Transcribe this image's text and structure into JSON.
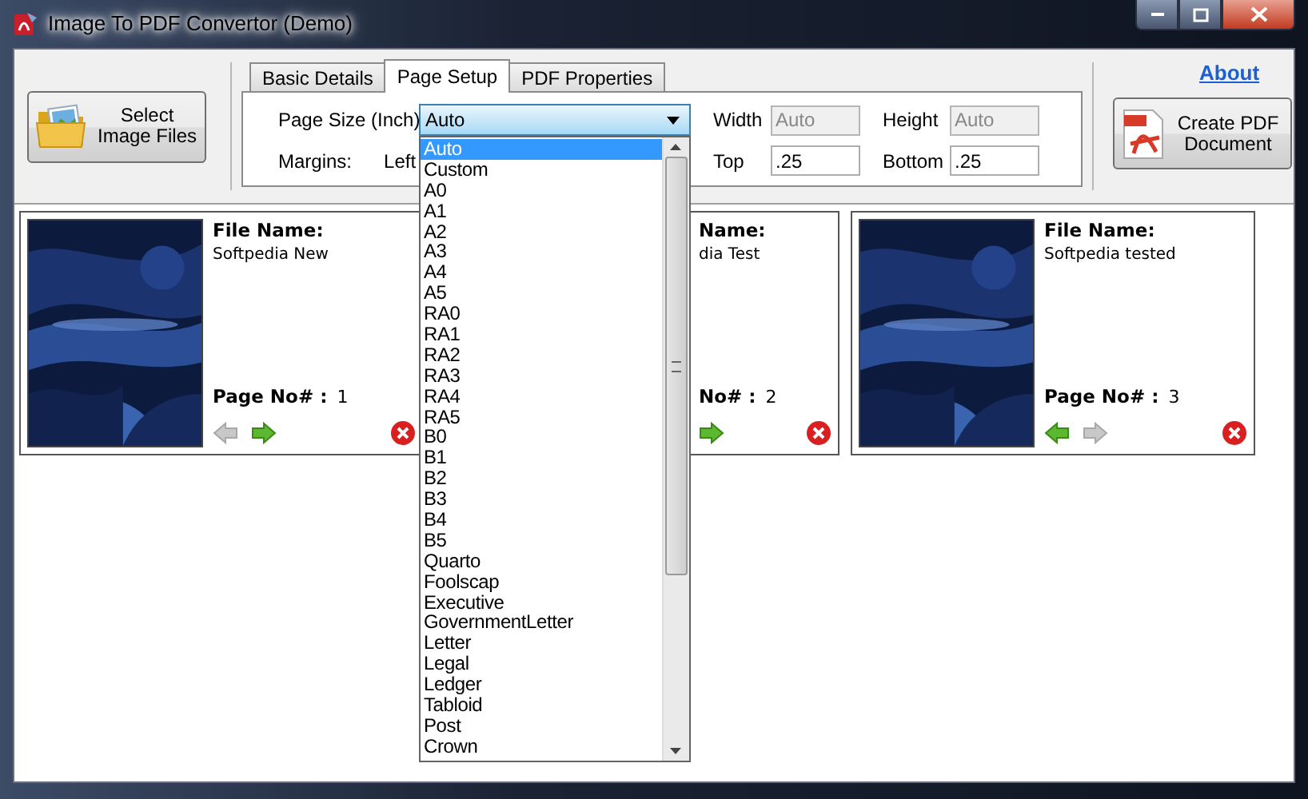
{
  "window": {
    "title": "Image To PDF Convertor (Demo)"
  },
  "toolbar": {
    "select_button": "Select Image Files",
    "about_link": "About",
    "create_button": "Create PDF Document"
  },
  "tabs": [
    {
      "label": "Basic Details",
      "selected": false
    },
    {
      "label": "Page Setup",
      "selected": true
    },
    {
      "label": "PDF Properties",
      "selected": false
    }
  ],
  "page_setup": {
    "page_size_label": "Page Size (Inch)",
    "page_size": {
      "value": "Auto",
      "expanded": true,
      "options": [
        {
          "label": "Auto",
          "selected": true
        },
        {
          "label": "Custom",
          "selected": false
        },
        {
          "label": "A0",
          "selected": false
        },
        {
          "label": "A1",
          "selected": false
        },
        {
          "label": "A2",
          "selected": false
        },
        {
          "label": "A3",
          "selected": false
        },
        {
          "label": "A4",
          "selected": false
        },
        {
          "label": "A5",
          "selected": false
        },
        {
          "label": "RA0",
          "selected": false
        },
        {
          "label": "RA1",
          "selected": false
        },
        {
          "label": "RA2",
          "selected": false
        },
        {
          "label": "RA3",
          "selected": false
        },
        {
          "label": "RA4",
          "selected": false
        },
        {
          "label": "RA5",
          "selected": false
        },
        {
          "label": "B0",
          "selected": false
        },
        {
          "label": "B1",
          "selected": false
        },
        {
          "label": "B2",
          "selected": false
        },
        {
          "label": "B3",
          "selected": false
        },
        {
          "label": "B4",
          "selected": false
        },
        {
          "label": "B5",
          "selected": false
        },
        {
          "label": "Quarto",
          "selected": false
        },
        {
          "label": "Foolscap",
          "selected": false
        },
        {
          "label": "Executive",
          "selected": false
        },
        {
          "label": "GovernmentLetter",
          "selected": false
        },
        {
          "label": "Letter",
          "selected": false
        },
        {
          "label": "Legal",
          "selected": false
        },
        {
          "label": "Ledger",
          "selected": false
        },
        {
          "label": "Tabloid",
          "selected": false
        },
        {
          "label": "Post",
          "selected": false
        },
        {
          "label": "Crown",
          "selected": false
        }
      ]
    },
    "width_label": "Width",
    "width": {
      "value": "Auto",
      "disabled": true
    },
    "height_label": "Height",
    "height": {
      "value": "Auto",
      "disabled": true
    },
    "margins_label": "Margins:",
    "left_label": "Left",
    "top_label": "Top",
    "top": {
      "value": ".25",
      "disabled": false
    },
    "bottom_label": "Bottom",
    "bottom": {
      "value": ".25",
      "disabled": false
    }
  },
  "cards": [
    {
      "file_label": "File Name:",
      "file_name": "Softpedia New",
      "page_label": "Page No# :",
      "page_number": "1",
      "covered": false,
      "prev_enabled": false,
      "next_enabled": true
    },
    {
      "file_label": "Name:",
      "file_name": "dia Test",
      "page_label": "No# :",
      "page_number": "2",
      "covered": true,
      "next_enabled": true
    },
    {
      "file_label": "File Name:",
      "file_name": "Softpedia tested",
      "page_label": "Page No# :",
      "page_number": "3",
      "covered": false,
      "prev_enabled": true,
      "next_enabled": false
    }
  ]
}
